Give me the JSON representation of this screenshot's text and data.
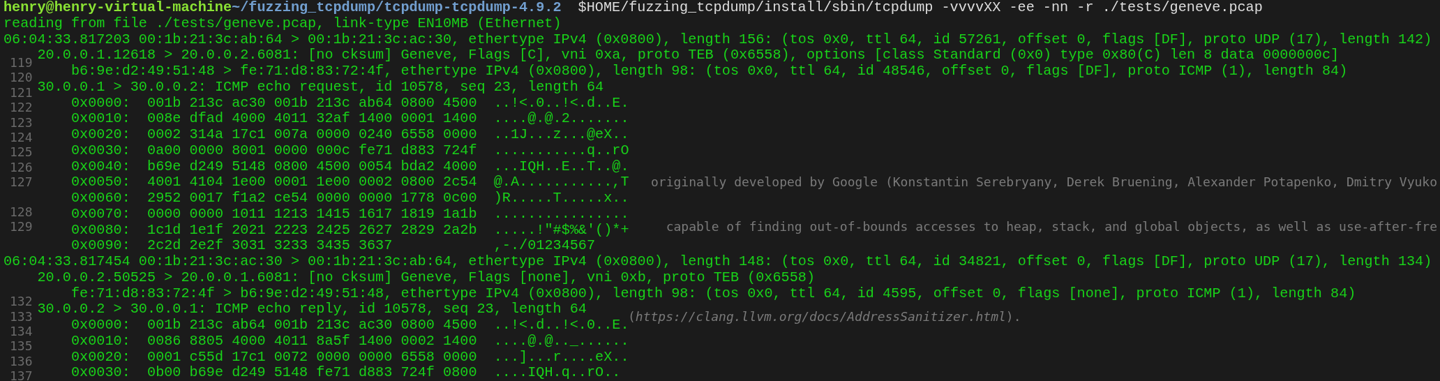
{
  "terminal": {
    "lines": [
      {
        "kind": "prompt",
        "user_host": "henry@henry-virtual-machine",
        "path": "~/fuzzing_tcpdump/tcpdump-tcpdump-4.9.2",
        "command": "$HOME/fuzzing_tcpdump/install/sbin/tcpdump -vvvvXX -ee -nn -r ./tests/geneve.pcap"
      },
      {
        "kind": "info",
        "text": "reading from file ./tests/geneve.pcap, link-type EN10MB (Ethernet)"
      },
      {
        "kind": "packet",
        "text": "06:04:33.817203 00:1b:21:3c:ab:64 > 00:1b:21:3c:ac:30, ethertype IPv4 (0x0800), length 156: (tos 0x0, ttl 64, id 57261, offset 0, flags [DF], proto UDP (17), length 142)"
      },
      {
        "kind": "detail",
        "text": "20.0.0.1.12618 > 20.0.0.2.6081: [no cksum] Geneve, Flags [C], vni 0xa, proto TEB (0x6558), options [class Standard (0x0) type 0x80(C) len 8 data 0000000c]"
      },
      {
        "kind": "hex",
        "text": "b6:9e:d2:49:51:48 > fe:71:d8:83:72:4f, ethertype IPv4 (0x0800), length 98: (tos 0x0, ttl 64, id 48546, offset 0, flags [DF], proto ICMP (1), length 84)"
      },
      {
        "kind": "detail",
        "text": "30.0.0.1 > 30.0.0.2: ICMP echo request, id 10578, seq 23, length 64"
      },
      {
        "kind": "hex",
        "text": "0x0000:  001b 213c ac30 001b 213c ab64 0800 4500  ..!<.0..!<.d..E."
      },
      {
        "kind": "hex",
        "text": "0x0010:  008e dfad 4000 4011 32af 1400 0001 1400  ....@.@.2......."
      },
      {
        "kind": "hex",
        "text": "0x0020:  0002 314a 17c1 007a 0000 0240 6558 0000  ..1J...z...@eX.."
      },
      {
        "kind": "hex",
        "text": "0x0030:  0a00 0000 8001 0000 000c fe71 d883 724f  ...........q..rO"
      },
      {
        "kind": "hex",
        "text": "0x0040:  b69e d249 5148 0800 4500 0054 bda2 4000  ...IQH..E..T..@."
      },
      {
        "kind": "hex",
        "text": "0x0050:  4001 4104 1e00 0001 1e00 0002 0800 2c54  @.A...........,T"
      },
      {
        "kind": "hex",
        "text": "0x0060:  2952 0017 f1a2 ce54 0000 0000 1778 0c00  )R.....T.....x.."
      },
      {
        "kind": "hex",
        "text": "0x0070:  0000 0000 1011 1213 1415 1617 1819 1a1b  ................"
      },
      {
        "kind": "hex",
        "text": "0x0080:  1c1d 1e1f 2021 2223 2425 2627 2829 2a2b  .....!\"#$%&'()*+"
      },
      {
        "kind": "hex",
        "text": "0x0090:  2c2d 2e2f 3031 3233 3435 3637            ,-./01234567"
      },
      {
        "kind": "packet",
        "text": "06:04:33.817454 00:1b:21:3c:ac:30 > 00:1b:21:3c:ab:64, ethertype IPv4 (0x0800), length 148: (tos 0x0, ttl 64, id 34821, offset 0, flags [DF], proto UDP (17), length 134)"
      },
      {
        "kind": "detail",
        "text": "20.0.0.2.50525 > 20.0.0.1.6081: [no cksum] Geneve, Flags [none], vni 0xb, proto TEB (0x6558)"
      },
      {
        "kind": "hex",
        "text": "fe:71:d8:83:72:4f > b6:9e:d2:49:51:48, ethertype IPv4 (0x0800), length 98: (tos 0x0, ttl 64, id 4595, offset 0, flags [none], proto ICMP (1), length 84)"
      },
      {
        "kind": "detail",
        "text": "30.0.0.2 > 30.0.0.1: ICMP echo reply, id 10578, seq 23, length 64"
      },
      {
        "kind": "hex",
        "text": "0x0000:  001b 213c ab64 001b 213c ac30 0800 4500  ..!<.d..!<.0..E."
      },
      {
        "kind": "hex",
        "text": "0x0010:  0086 8805 4000 4011 8a5f 1400 0002 1400  ....@.@.._......"
      },
      {
        "kind": "hex",
        "text": "0x0020:  0001 c55d 17c1 0072 0000 0000 6558 0000  ...]...r....eX.."
      },
      {
        "kind": "hex",
        "text": "0x0030:  0b00 b69e d249 5148 fe71 d883 724f 0800  ....IQH.q..rO.."
      }
    ]
  },
  "editor": {
    "rows": [
      {
        "kind": "line",
        "number": "119"
      },
      {
        "kind": "line",
        "number": "120"
      },
      {
        "kind": "line",
        "number": "121"
      },
      {
        "kind": "line",
        "number": "122"
      },
      {
        "kind": "line",
        "number": "123"
      },
      {
        "kind": "line",
        "number": "124"
      },
      {
        "kind": "line",
        "number": "125"
      },
      {
        "kind": "line",
        "number": "126"
      },
      {
        "kind": "line",
        "number": "127",
        "tail": "originally developed by Google (Konstantin Serebryany, Derek Bruening, Alexander Potapenko, Dmitry Vyuko"
      },
      {
        "kind": "blank"
      },
      {
        "kind": "line",
        "number": "128"
      },
      {
        "kind": "line",
        "number": "129",
        "tail": "capable of finding out-of-bounds accesses to heap, stack, and global objects, as well as use-after-fre"
      },
      {
        "kind": "blank"
      },
      {
        "kind": "blank"
      },
      {
        "kind": "blank"
      },
      {
        "kind": "blank"
      },
      {
        "kind": "line",
        "number": "132"
      },
      {
        "kind": "line",
        "number": "133",
        "link": "(*https://clang.llvm.org/docs/AddressSanitizer.html*)."
      },
      {
        "kind": "line",
        "number": "134"
      },
      {
        "kind": "line",
        "number": "135"
      },
      {
        "kind": "line",
        "number": "136"
      },
      {
        "kind": "line",
        "number": "137"
      }
    ]
  }
}
